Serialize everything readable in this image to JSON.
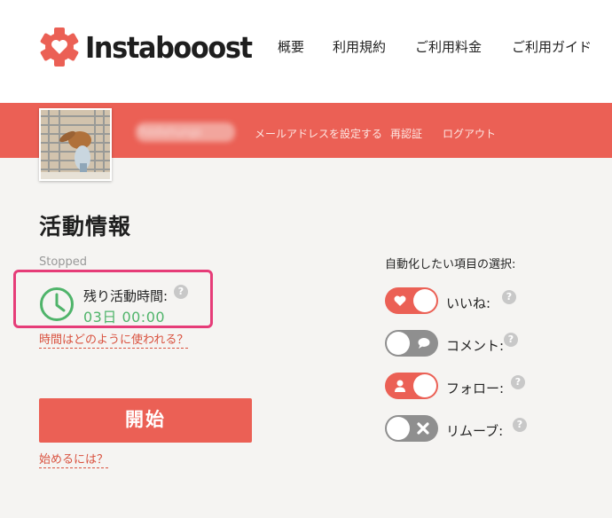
{
  "header": {
    "logo_text": "Instabooost",
    "nav": [
      "概要",
      "利用規約",
      "ご利用料金",
      "ご利用ガイド"
    ]
  },
  "userbar": {
    "username": "fiddlehungs",
    "links": [
      "メールアドレスを設定する",
      "再認証",
      "ログアウト"
    ]
  },
  "activity": {
    "title": "活動情報",
    "status": "Stopped",
    "remaining_label": "残り活動時間:",
    "remaining_value": "03日 00:00",
    "help_symbol": "?",
    "how_used_link": "時間はどのように使われる？",
    "start_button": "開始",
    "how_to_start_link": "始めるには？"
  },
  "automation": {
    "title": "自動化したい項目の選択:",
    "options": [
      {
        "label": "いいね:",
        "enabled": true,
        "icon": "heart-icon"
      },
      {
        "label": "コメント:",
        "enabled": false,
        "icon": "comment-icon"
      },
      {
        "label": "フォロー:",
        "enabled": true,
        "icon": "person-icon"
      },
      {
        "label": "リムーブ:",
        "enabled": false,
        "icon": "x-icon"
      }
    ]
  },
  "colors": {
    "accent": "#eb6055",
    "highlight": "#e63c78",
    "time_green": "#4fb46a",
    "toggle_off": "#8f8f8f"
  }
}
